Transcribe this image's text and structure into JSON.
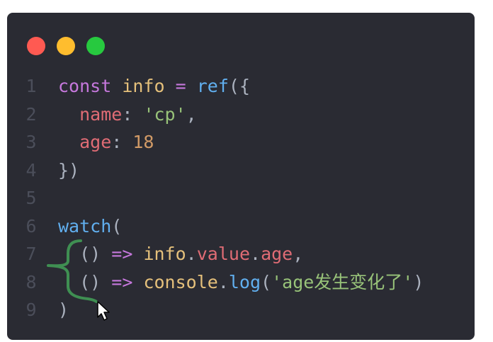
{
  "window": {
    "buttons": [
      "close",
      "minimize",
      "maximize"
    ],
    "colors": {
      "close": "#ff5a52",
      "minimize": "#ffbd2e",
      "maximize": "#27c93f",
      "background": "#2a2b33"
    }
  },
  "code": {
    "lines": [
      {
        "number": "1",
        "tokens": [
          {
            "text": "const",
            "type": "kw"
          },
          {
            "text": " ",
            "type": "plain"
          },
          {
            "text": "info",
            "type": "var"
          },
          {
            "text": " ",
            "type": "plain"
          },
          {
            "text": "=",
            "type": "op"
          },
          {
            "text": " ",
            "type": "plain"
          },
          {
            "text": "ref",
            "type": "fn"
          },
          {
            "text": "({",
            "type": "punc"
          }
        ]
      },
      {
        "number": "2",
        "tokens": [
          {
            "text": "  ",
            "type": "plain"
          },
          {
            "text": "name",
            "type": "prop"
          },
          {
            "text": ": ",
            "type": "punc"
          },
          {
            "text": "'cp'",
            "type": "str"
          },
          {
            "text": ",",
            "type": "punc"
          }
        ]
      },
      {
        "number": "3",
        "tokens": [
          {
            "text": "  ",
            "type": "plain"
          },
          {
            "text": "age",
            "type": "prop"
          },
          {
            "text": ": ",
            "type": "punc"
          },
          {
            "text": "18",
            "type": "num"
          }
        ]
      },
      {
        "number": "4",
        "tokens": [
          {
            "text": "})",
            "type": "punc"
          }
        ]
      },
      {
        "number": "5",
        "tokens": []
      },
      {
        "number": "6",
        "tokens": [
          {
            "text": "watch",
            "type": "fn"
          },
          {
            "text": "(",
            "type": "punc"
          }
        ]
      },
      {
        "number": "7",
        "tokens": [
          {
            "text": "  ",
            "type": "plain"
          },
          {
            "text": "()",
            "type": "punc"
          },
          {
            "text": " ",
            "type": "plain"
          },
          {
            "text": "=>",
            "type": "op"
          },
          {
            "text": " ",
            "type": "plain"
          },
          {
            "text": "info",
            "type": "var"
          },
          {
            "text": ".",
            "type": "punc"
          },
          {
            "text": "value",
            "type": "prop"
          },
          {
            "text": ".",
            "type": "punc"
          },
          {
            "text": "age",
            "type": "prop"
          },
          {
            "text": ",",
            "type": "punc"
          }
        ]
      },
      {
        "number": "8",
        "tokens": [
          {
            "text": "  ",
            "type": "plain"
          },
          {
            "text": "()",
            "type": "punc"
          },
          {
            "text": " ",
            "type": "plain"
          },
          {
            "text": "=>",
            "type": "op"
          },
          {
            "text": " ",
            "type": "plain"
          },
          {
            "text": "console",
            "type": "var"
          },
          {
            "text": ".",
            "type": "punc"
          },
          {
            "text": "log",
            "type": "fn"
          },
          {
            "text": "(",
            "type": "punc"
          },
          {
            "text": "'age发生变化了'",
            "type": "str"
          },
          {
            "text": ")",
            "type": "punc"
          }
        ]
      },
      {
        "number": "9",
        "tokens": [
          {
            "text": ")",
            "type": "punc"
          }
        ]
      }
    ]
  },
  "annotation": {
    "color": "#3f8f52",
    "icon": "curly-brace-annotation"
  },
  "cursor": {
    "icon": "mouse-pointer-icon"
  }
}
